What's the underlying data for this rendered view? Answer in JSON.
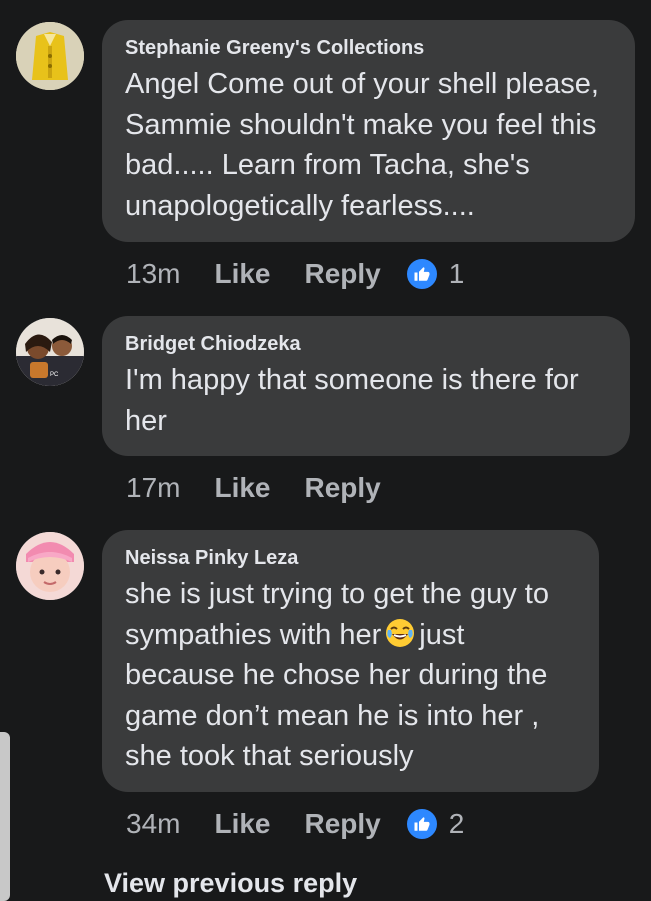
{
  "comments": [
    {
      "author": "Stephanie Greeny's Collections",
      "text": "Angel Come out of your shell please, Sammie shouldn't make you feel this bad..... Learn from Tacha, she's unapologetically fearless....",
      "time": "13m",
      "like_label": "Like",
      "reply_label": "Reply",
      "reaction_count": "1",
      "reaction_icon": "thumbs-up-icon"
    },
    {
      "author": "Bridget Chiodzeka",
      "text": "I'm happy that someone is there for her",
      "time": "17m",
      "like_label": "Like",
      "reply_label": "Reply"
    },
    {
      "author": "Neissa Pinky Leza",
      "text_before_emoji": "she is just trying to get the guy to sympathies with her",
      "emoji": "face-with-tears-of-joy-icon",
      "text_after_emoji": "just because he chose her during the game don’t mean he is into her , she took that seriously",
      "time": "34m",
      "like_label": "Like",
      "reply_label": "Reply",
      "reaction_count": "2",
      "reaction_icon": "thumbs-up-icon"
    }
  ],
  "view_previous_reply": "View previous reply",
  "colors": {
    "background": "#18191a",
    "bubble": "#3a3b3c",
    "text": "#e4e6eb",
    "secondary_text": "#b0b3b8",
    "like_blue": "#2d88ff"
  }
}
